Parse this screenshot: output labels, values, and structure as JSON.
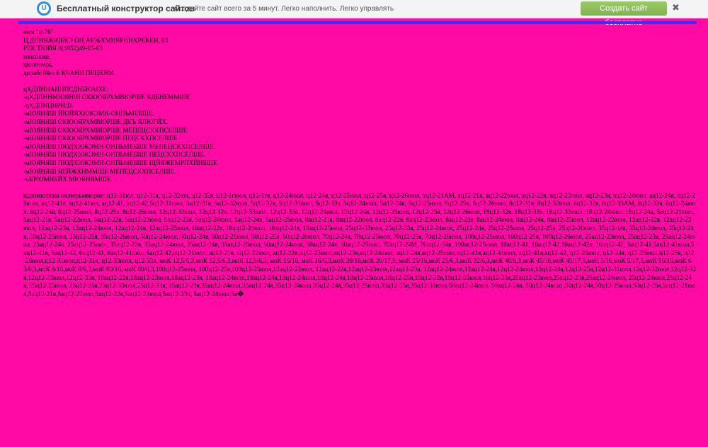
{
  "topbar": {
    "logo_glyph": "U",
    "brand": "Бесплатный конструктор сайтов",
    "tagline": "Создайте сайт всего за 5 минут. Легко наполнить. Легко управлять",
    "cta_label": "Создать сайт бесплатно",
    "close_glyph": "✖"
  },
  "content": {
    "header_block": "ним \"аг76\"\nЦ,ДПНЯЖЮБКЭ ОН,АЮБХМНЯРПНХРЕКЕИ, 83\nРЕК ТЮЙЯ 8(4852)49-05-03\nмюсокже,\nцюопомрь,\nдирабобйю Б КЧАНИ ПЕЦКНМ.",
    "list_block": "цХДПННАНППСДНБЮМХЕ:\n-цХДПННМЮЯНШ ОКЮОЯРХМВЮРШЕ ЯДБНЕММШЕ.\n-цХДПНЦНРНШ.\n-мЮЯНЯШ ЙЮЙЯХЮКЭМН-ОНПЬМЕБШЕ.\n-мЮЯНЯШ ОКЮОЯРХМВЮРШЕ ДКЪ ЯЛЮГЙХ.\n-мЮЯНЯШ ОКЮОЯРХМВЮРШЕ МЕПЕЦСКХПСЕЛШЕ.\n-мЮЯНЯШ ОКЮОЯРХМВЮРШЕ ПЕЦСКХПСЕЛШЕ.\n-мЮЯНЯШ ПЮДХЮКЭМН-ОНПЬМЕБШЕ МЕПЕЦСКХПСЕЛШЕ.\n-мЮЯНЯШ ПЮДХЮКЭМН-ОНПЬМЕБШЕ ПЕЦСКХПСЕЛШЕ.\n-мЮЯНЯШ ПЮДХЮКЭМН-ОНПЬМЕБШЕ ЩЙЯЖЕМРПХЙНБШЕ.\n-мЮЯНЯШ ЯЕЙЖХНММШЕ МЕПЕЦСКХПСЕЛШЕ.\n-ъЯРЮМНБЙХ МЮЯНЯМШЕ.",
    "long_text": "пдапмюляаш оклюрьмвюрие: ц12-31юл, ц12-31я, ц12-32юл, ц12-32я, ц12-1гюол, ц12-1гя, ц12-24юол, ц12-24я, ц12-25юол, ц12-25я, ц12-26юол, ац12-21АМ, ац12-21я, ац12-22юол, ац12-22я, ац12-23юол, ац12-23я, ац12-24юол, ац12-24я, ац12-25юол, ац12-41я, ац12-41юл, ац12-41, ац12-42,5ц12-31юол, 5ц12-31я, 5ц12-32юол, 5ц12-32я, 5ц12-33юол, 5ц12-33я, 5ц12-24юол, 5ц12-24я, 5ц12-25юол, 5ц12-25я, 5ц12-26юол, 8ц12-31я, 8ц12-32юол, 8ц12-32я, 8ц12-33АМ, 8ц12-33я, 8ц12-24юол, 8ц12-24я, 8ц12-25юол, 8ц12-25я, 8ц12-26юол, 12ц12-32юол, 12ц12-32я, 12ц12-33юол, 12ц12-33я, 12ц12-24юол, 12ц12-24я, 12ц12-25юол, 12ц12-25я, 12ц12-26юол, 18ц12-32я, 18ц12-33я, 18ц12-33юол, 18ц12-24юол, 18ц12-24я, 5ац12-21юол, 5ац12-21я, 5ац12-22юол, 5ац12-22я, 5ац12-23юол, 5ац12-23я, 5ац12-24юол, 5ац12-24я, 5ац12-25юол, 8ац12-21я, 8ац12-22юол, 8ац12-22я, 8ац12-23юол, 8ац12-23я, 8ац12-24юол, 8ац12-24я, 8ац12-25юол, 12ац12-22юол, 12ац12-22я, 12ац12-23юол, 12ац12-23я, 12ац12-24юол, 12ац12-24я, 12ац12-25юол, 18ац12-22я, 18ац12-24юол, 18ац12-24я, 18ац12-25юол, 25ц12-33юол, 25ц12-33я, 25ц12-24юол, 25ц12-24я, 25ц12-25юол, 25ц12-25я, 25ц12-26юол, 35ц12-1гя, 35ц12-24юол, 35ц12-24я, 35ц12-25юол, 35ц12-25я, 35ц12-26юол, 50ц12-24юол, 50ц12-24я, 50ц12-25юол, 50ц12-25я, 50ц12-26юол, 70ц12-24я, 70ц12-25юол, 70ц12-25я, 70ц12-26юол, 100ц12-25юол, 100ц12-25я, 100ц12-26юол, 25ац12-23юол, 25ац12-23я, 25ац12-24юол, 25ац12-24я, 25ац12-25юол, 35ац12-23я, 35ац12-24юол, 35ац12-24я, 35ац12-25юол, 50ац12-24юол, 50ац12-24я, 50ац12-25юол, 70ац12-24М, 70ац12-24я, 100ац12-25юол, 10ац12-41, 10ац12-42,10ац12-42я, 16ац12-42, 3ац12-41,5ац12-41юол,5ац12-41я, 5ац12-42, 6ац12-41, 6ац12-41юол, 6ац12-42,ац12-21юол, ац12-21я, ац12-22юол, ац12-22я,ац12-23юол,ац12-23я,ац12-24юол, ац12-24я,ац12-25юол,ац12-41я,ац12-41юол, ац12-41я,ац12-42, ц12-24юол, ц12-24я, ц12-25юол,ц12-25я, ц12-26юол,ц12-31юол,ц12-31я, ц12-33юол, ц12-33я, моК 12,5/6,3,моК 12,5/6,3,моК 12,5/6,3, моК 16/16, моК 16/6,3,моК 20/16,моК 20/17,5, моК 25/16,моК 25/6,3,моК 32/6,3,моК 40/6,3,моК 45/16,моК 45/17,5,моК 5/16,моК 5/17,5,моК 56/16,моК 63/6,3,моК 8/16,моК 8/6,3,моК 80/16, моК 80/6,3,100ц12-25юол, 100ц12-25я,100ц12-26юол,12ац12-22юол, 12ац12-22я,12ац12-23юол,12ац12-23я, 12ац12-24юол,12ац12-24я,12ц12-24юол,12ц12-24я,12ц12-25я,12ц12-31юол,12ц12-32юол,12ц12-32я,12ц12-33юол,12ц12-33я, 18ац12-22я,18ац12-23юол,18ац12-23я, 18ац12-24юол,18ац12-24я,18ц12-24юол,18ц12-24я,18ц12-25юол,18ц12-25я,18ц12-32я,18ц12-33юол,18ц12-33я,25ац12-23юол,25ац12-23я,25ац12-24юол, 25ц12-24юол,25ц12-24я, 25ц12-25юол, 25ц12-25я,25ц12-33юол,25ц12-33я, 35ац12-23я,35ац12-24юол,35ац12-24я,35ц12-24юол,35ц12-24я,35ц12-25юол,35ц12-25я,35ц12-33юол,50ац12-24юол, 50ац12-24я, 50ц12-24юол ,50ц12-24я,50ц12-25юол,50ц12-25я,5ац12-21юол,5ац12-21я,5ац12-22юол,5ац12-22я,5ац12-23юол,5ац12-23я, 5ац12-24юол,5а�"
  }
}
